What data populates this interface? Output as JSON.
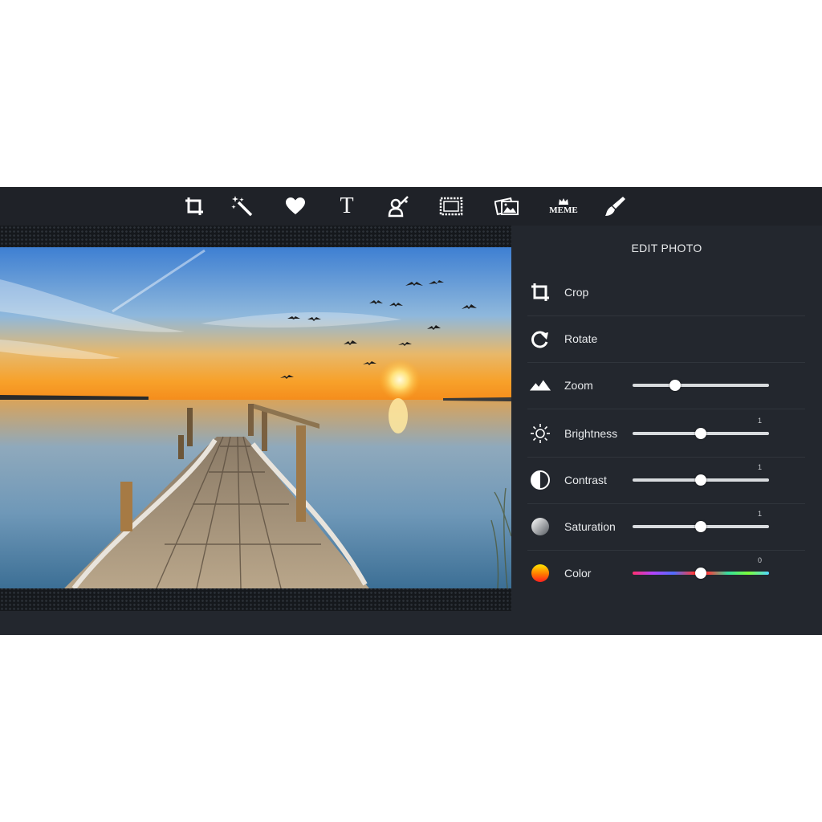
{
  "toolbar": {
    "tools": [
      {
        "name": "crop-tool",
        "icon": "crop-icon"
      },
      {
        "name": "magic-wand-tool",
        "icon": "magic-wand-icon"
      },
      {
        "name": "sticker-tool",
        "icon": "heart-icon"
      },
      {
        "name": "text-tool",
        "icon": "text-icon",
        "glyph": "T"
      },
      {
        "name": "draw-tool",
        "icon": "portrait-brush-icon"
      },
      {
        "name": "frame-tool",
        "icon": "frame-icon"
      },
      {
        "name": "photo-tool",
        "icon": "photos-icon"
      },
      {
        "name": "meme-tool",
        "icon": "meme-icon",
        "glyph": "MEME"
      },
      {
        "name": "brush-tool",
        "icon": "brush-icon"
      }
    ]
  },
  "panel": {
    "title": "EDIT PHOTO",
    "items": [
      {
        "label": "Crop",
        "icon": "crop-icon"
      },
      {
        "label": "Rotate",
        "icon": "rotate-icon"
      },
      {
        "label": "Zoom",
        "icon": "mountains-icon",
        "slider_value_fraction": 0.31
      },
      {
        "label": "Brightness",
        "icon": "sun-icon",
        "value_label": "1",
        "slider_value_fraction": 0.5
      },
      {
        "label": "Contrast",
        "icon": "contrast-icon",
        "value_label": "1",
        "slider_value_fraction": 0.5
      },
      {
        "label": "Saturation",
        "icon": "saturation-icon",
        "value_label": "1",
        "slider_value_fraction": 0.5
      },
      {
        "label": "Color",
        "icon": "color-gradient-icon",
        "value_label": "0",
        "slider_value_fraction": 0.5
      }
    ]
  },
  "colors": {
    "app_background": "#23272e",
    "toolbar_background": "#1f2228",
    "slider_track": "#d8dbde",
    "knob": "#ffffff"
  }
}
